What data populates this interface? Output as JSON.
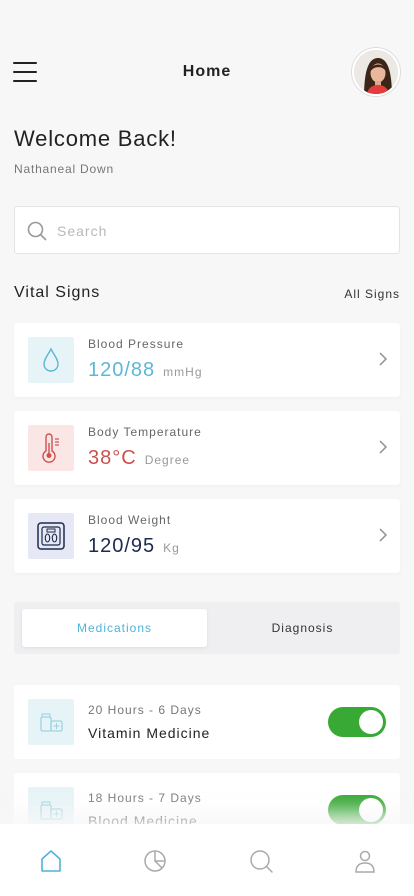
{
  "header": {
    "title": "Home"
  },
  "welcome": {
    "greeting": "Welcome Back!",
    "user_name": "Nathaneal Down"
  },
  "search": {
    "placeholder": "Search",
    "value": ""
  },
  "vitals": {
    "title": "Vital Signs",
    "all_link": "All Signs",
    "items": [
      {
        "label": "Blood Pressure",
        "value": "120/88",
        "unit": "mmHg",
        "icon": "drop-icon",
        "color": "#5bb8d6",
        "icon_bg": "#e7f4f7"
      },
      {
        "label": "Body Temperature",
        "value": "38°C",
        "unit": "Degree",
        "icon": "thermometer-icon",
        "color": "#cf4f4f",
        "icon_bg": "#fbe6e6"
      },
      {
        "label": "Blood Weight",
        "value": "120/95",
        "unit": "Kg",
        "icon": "scale-icon",
        "color": "#1d2a4e",
        "icon_bg": "#e6e9f5"
      }
    ]
  },
  "tabs": {
    "active": "Medications",
    "inactive": "Diagnosis"
  },
  "medications": [
    {
      "time": "20 Hours - 6 Days",
      "name": "Vitamin Medicine",
      "enabled": true,
      "icon": "pill-bottles-icon"
    },
    {
      "time": "18 Hours - 7 Days",
      "name": "Blood Medicine",
      "enabled": true,
      "icon": "pill-bottles-icon"
    }
  ],
  "nav": [
    "home-icon",
    "chart-icon",
    "search-icon",
    "profile-icon"
  ],
  "colors": {
    "accent": "#4fb3d9",
    "toggle_on": "#38a935"
  }
}
